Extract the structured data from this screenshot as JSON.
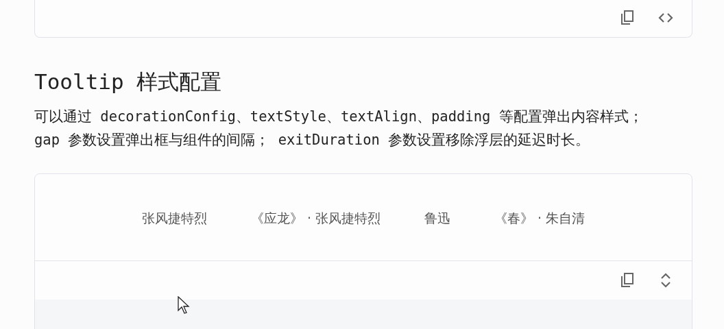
{
  "cards": [
    {
      "code_expanded": false
    },
    {
      "code_expanded": true
    }
  ],
  "section": {
    "title": "Tooltip 样式配置",
    "description": "可以通过 decorationConfig、textStyle、textAlign、padding 等配置弹出内容样式； gap 参数设置弹出框与组件的间隔； exitDuration 参数设置移除浮层的延迟时长。"
  },
  "demo": {
    "items": [
      "张风捷特烈",
      "《应龙》 · 张风捷特烈",
      "鲁迅",
      "《春》 · 朱自清"
    ]
  }
}
